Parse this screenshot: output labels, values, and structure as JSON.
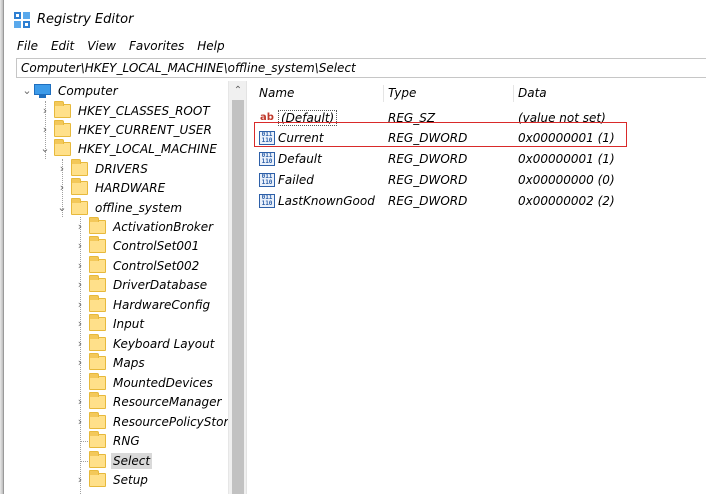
{
  "window": {
    "title": "Registry Editor"
  },
  "menu": [
    "File",
    "Edit",
    "View",
    "Favorites",
    "Help"
  ],
  "address": "Computer\\HKEY_LOCAL_MACHINE\\offline_system\\Select",
  "tree": {
    "root": "Computer",
    "hives": [
      "HKEY_CLASSES_ROOT",
      "HKEY_CURRENT_USER",
      "HKEY_LOCAL_MACHINE"
    ],
    "hklm_children": [
      "DRIVERS",
      "HARDWARE",
      "offline_system"
    ],
    "offline_system_children": [
      "ActivationBroker",
      "ControlSet001",
      "ControlSet002",
      "DriverDatabase",
      "HardwareConfig",
      "Input",
      "Keyboard Layout",
      "Maps",
      "MountedDevices",
      "ResourceManager",
      "ResourcePolicyStore",
      "RNG",
      "Select",
      "Setup"
    ],
    "selected": "Select"
  },
  "list": {
    "headers": {
      "name": "Name",
      "type": "Type",
      "data": "Data"
    },
    "rows": [
      {
        "icon": "string-value-icon",
        "name": "(Default)",
        "type": "REG_SZ",
        "data": "(value not set)"
      },
      {
        "icon": "dword-value-icon",
        "name": "Current",
        "type": "REG_DWORD",
        "data": "0x00000001 (1)"
      },
      {
        "icon": "dword-value-icon",
        "name": "Default",
        "type": "REG_DWORD",
        "data": "0x00000001 (1)"
      },
      {
        "icon": "dword-value-icon",
        "name": "Failed",
        "type": "REG_DWORD",
        "data": "0x00000000 (0)"
      },
      {
        "icon": "dword-value-icon",
        "name": "LastKnownGood",
        "type": "REG_DWORD",
        "data": "0x00000002 (2)"
      }
    ]
  },
  "colors": {
    "highlight_border": "#d92a2a",
    "folder_fill": "#ffe08a",
    "selection": "#d9d9d9"
  }
}
